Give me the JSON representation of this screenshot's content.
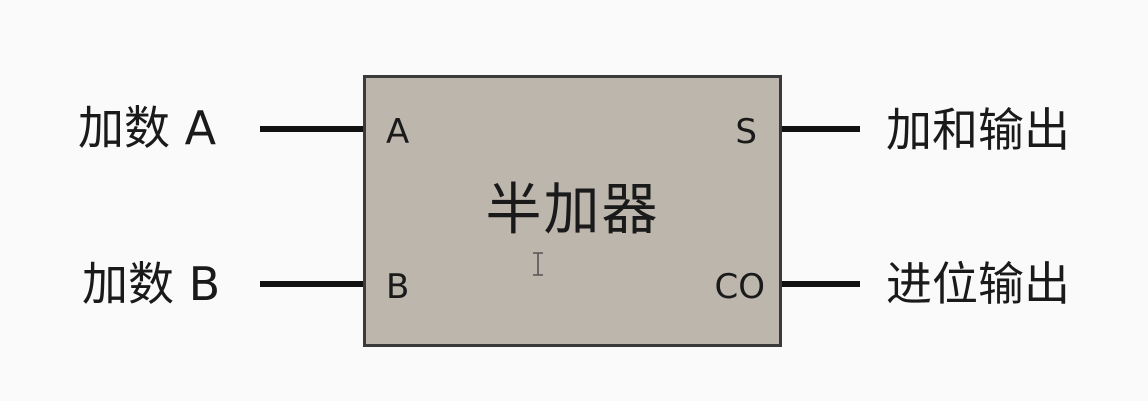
{
  "inputs": {
    "a": {
      "label": "加数 A",
      "pin": "A"
    },
    "b": {
      "label": "加数 B",
      "pin": "B"
    }
  },
  "outputs": {
    "s": {
      "label": "加和输出",
      "pin": "S"
    },
    "co": {
      "label": "进位输出",
      "pin": "CO"
    }
  },
  "block": {
    "title": "半加器",
    "fill_color": "#bcb6ad",
    "border_color": "#3a3a3a"
  },
  "icons": {
    "cursor": "text-cursor-icon"
  }
}
